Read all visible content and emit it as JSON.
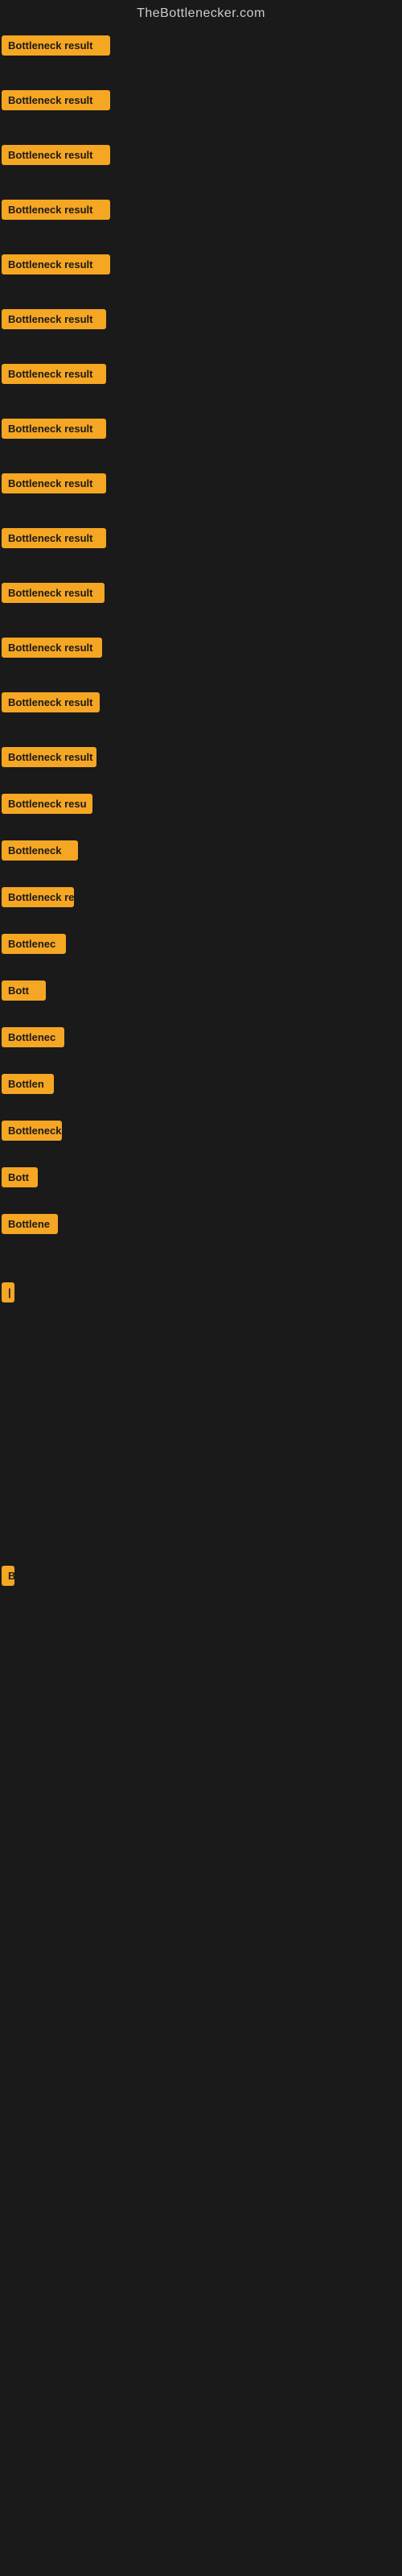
{
  "site": {
    "title": "TheBottlenecker.com"
  },
  "items": [
    {
      "id": 1,
      "label": "Bottleneck result",
      "spacer": "lg"
    },
    {
      "id": 2,
      "label": "Bottleneck result",
      "spacer": "lg"
    },
    {
      "id": 3,
      "label": "Bottleneck result",
      "spacer": "lg"
    },
    {
      "id": 4,
      "label": "Bottleneck result",
      "spacer": "lg"
    },
    {
      "id": 5,
      "label": "Bottleneck result",
      "spacer": "lg"
    },
    {
      "id": 6,
      "label": "Bottleneck result",
      "spacer": "lg"
    },
    {
      "id": 7,
      "label": "Bottleneck result",
      "spacer": "lg"
    },
    {
      "id": 8,
      "label": "Bottleneck result",
      "spacer": "lg"
    },
    {
      "id": 9,
      "label": "Bottleneck result",
      "spacer": "lg"
    },
    {
      "id": 10,
      "label": "Bottleneck result",
      "spacer": "lg"
    },
    {
      "id": 11,
      "label": "Bottleneck result",
      "spacer": "lg"
    },
    {
      "id": 12,
      "label": "Bottleneck result",
      "spacer": "lg"
    },
    {
      "id": 13,
      "label": "Bottleneck result",
      "spacer": "lg"
    },
    {
      "id": 14,
      "label": "Bottleneck result",
      "spacer": "md"
    },
    {
      "id": 15,
      "label": "Bottleneck resu",
      "spacer": "md"
    },
    {
      "id": 16,
      "label": "Bottleneck",
      "spacer": "md"
    },
    {
      "id": 17,
      "label": "Bottleneck re",
      "spacer": "md"
    },
    {
      "id": 18,
      "label": "Bottlenec",
      "spacer": "md"
    },
    {
      "id": 19,
      "label": "Bott",
      "spacer": "md"
    },
    {
      "id": 20,
      "label": "Bottlenec",
      "spacer": "md"
    },
    {
      "id": 21,
      "label": "Bottlen",
      "spacer": "md"
    },
    {
      "id": 22,
      "label": "Bottleneck",
      "spacer": "md"
    },
    {
      "id": 23,
      "label": "Bott",
      "spacer": "md"
    },
    {
      "id": 24,
      "label": "Bottlene",
      "spacer": "xl"
    },
    {
      "id": 25,
      "label": "|",
      "spacer": "xxl"
    }
  ],
  "bottom_item": {
    "label": "B"
  },
  "colors": {
    "badge_bg": "#f5a623",
    "badge_text": "#1a1a1a",
    "background": "#1a1a1a",
    "site_title": "#cccccc"
  }
}
